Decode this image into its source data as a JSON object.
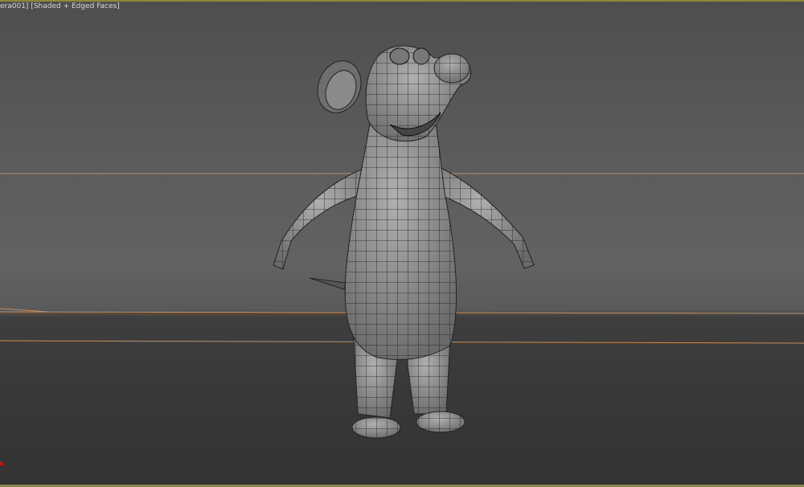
{
  "viewport": {
    "label": "era001] [Shaded + Edged Faces]",
    "active_border_color": "#8c8a3e",
    "horizon_line_color": "#d08a4a",
    "model": "mouse character mesh"
  }
}
